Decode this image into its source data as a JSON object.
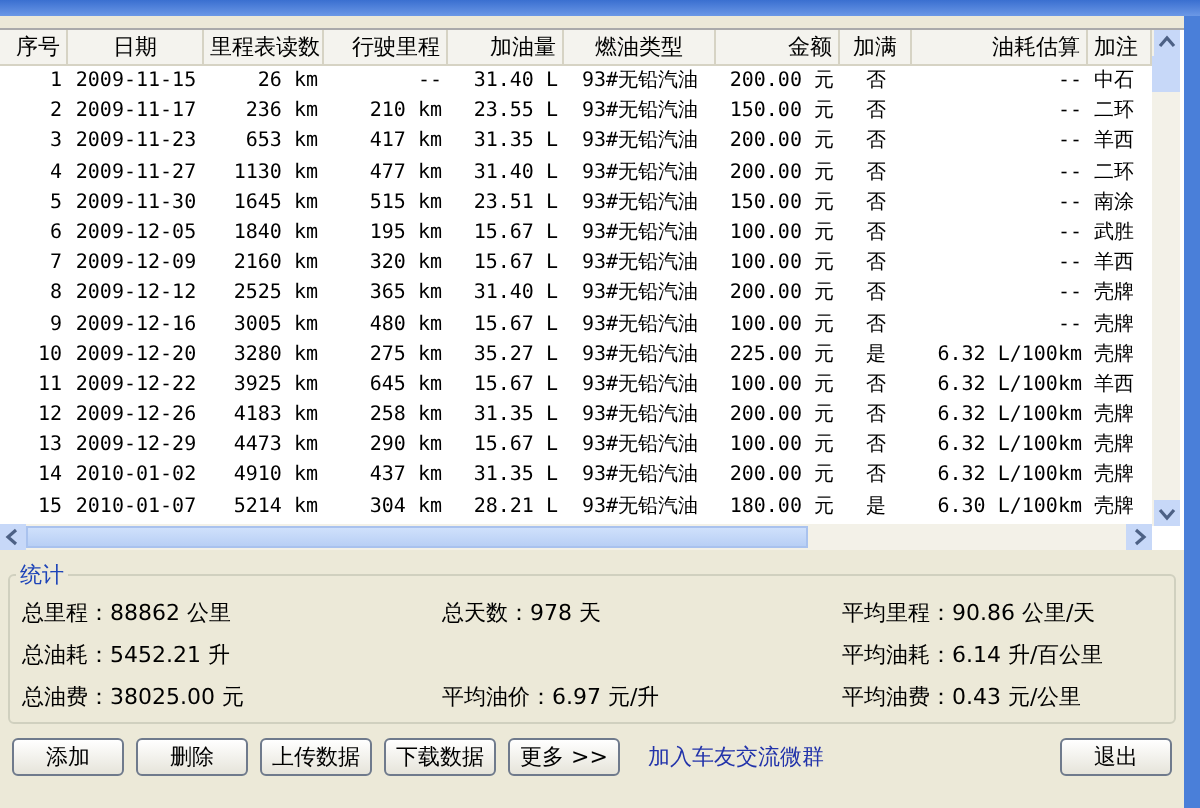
{
  "table": {
    "columns": [
      "序号",
      "日期",
      "里程表读数",
      "行驶里程",
      "加油量",
      "燃油类型",
      "金额",
      "加满",
      "油耗估算",
      "加注"
    ],
    "rows": [
      [
        "1",
        "2009-11-15",
        "26 km",
        "--",
        "31.40 L",
        "93#无铅汽油",
        "200.00 元",
        "否",
        "--",
        "中石"
      ],
      [
        "2",
        "2009-11-17",
        "236 km",
        "210 km",
        "23.55 L",
        "93#无铅汽油",
        "150.00 元",
        "否",
        "--",
        "二环"
      ],
      [
        "3",
        "2009-11-23",
        "653 km",
        "417 km",
        "31.35 L",
        "93#无铅汽油",
        "200.00 元",
        "否",
        "--",
        "羊西"
      ],
      [
        "4",
        "2009-11-27",
        "1130 km",
        "477 km",
        "31.40 L",
        "93#无铅汽油",
        "200.00 元",
        "否",
        "--",
        "二环"
      ],
      [
        "5",
        "2009-11-30",
        "1645 km",
        "515 km",
        "23.51 L",
        "93#无铅汽油",
        "150.00 元",
        "否",
        "--",
        "南涂"
      ],
      [
        "6",
        "2009-12-05",
        "1840 km",
        "195 km",
        "15.67 L",
        "93#无铅汽油",
        "100.00 元",
        "否",
        "--",
        "武胜"
      ],
      [
        "7",
        "2009-12-09",
        "2160 km",
        "320 km",
        "15.67 L",
        "93#无铅汽油",
        "100.00 元",
        "否",
        "--",
        "羊西"
      ],
      [
        "8",
        "2009-12-12",
        "2525 km",
        "365 km",
        "31.40 L",
        "93#无铅汽油",
        "200.00 元",
        "否",
        "--",
        "壳牌"
      ],
      [
        "9",
        "2009-12-16",
        "3005 km",
        "480 km",
        "15.67 L",
        "93#无铅汽油",
        "100.00 元",
        "否",
        "--",
        "壳牌"
      ],
      [
        "10",
        "2009-12-20",
        "3280 km",
        "275 km",
        "35.27 L",
        "93#无铅汽油",
        "225.00 元",
        "是",
        "6.32 L/100km",
        "壳牌"
      ],
      [
        "11",
        "2009-12-22",
        "3925 km",
        "645 km",
        "15.67 L",
        "93#无铅汽油",
        "100.00 元",
        "否",
        "6.32 L/100km",
        "羊西"
      ],
      [
        "12",
        "2009-12-26",
        "4183 km",
        "258 km",
        "31.35 L",
        "93#无铅汽油",
        "200.00 元",
        "否",
        "6.32 L/100km",
        "壳牌"
      ],
      [
        "13",
        "2009-12-29",
        "4473 km",
        "290 km",
        "15.67 L",
        "93#无铅汽油",
        "100.00 元",
        "否",
        "6.32 L/100km",
        "壳牌"
      ],
      [
        "14",
        "2010-01-02",
        "4910 km",
        "437 km",
        "31.35 L",
        "93#无铅汽油",
        "200.00 元",
        "否",
        "6.32 L/100km",
        "壳牌"
      ],
      [
        "15",
        "2010-01-07",
        "5214 km",
        "304 km",
        "28.21 L",
        "93#无铅汽油",
        "180.00 元",
        "是",
        "6.30 L/100km",
        "壳牌"
      ]
    ]
  },
  "stats": {
    "title": "统计",
    "rows": [
      {
        "left": "总里程：88862 公里",
        "middle": "总天数：978 天",
        "right": "平均里程：90.86 公里/天"
      },
      {
        "left": "总油耗：5452.21 升",
        "right": "平均油耗：6.14 升/百公里"
      },
      {
        "left": "总油费：38025.00 元",
        "middle": "平均油价：6.97 元/升",
        "right": "平均油费：0.43 元/公里"
      }
    ]
  },
  "buttons": [
    "添加",
    "删除",
    "上传数据",
    "下载数据",
    "更多 >>"
  ],
  "link": "加入车友交流微群",
  "exit_button": "退出"
}
